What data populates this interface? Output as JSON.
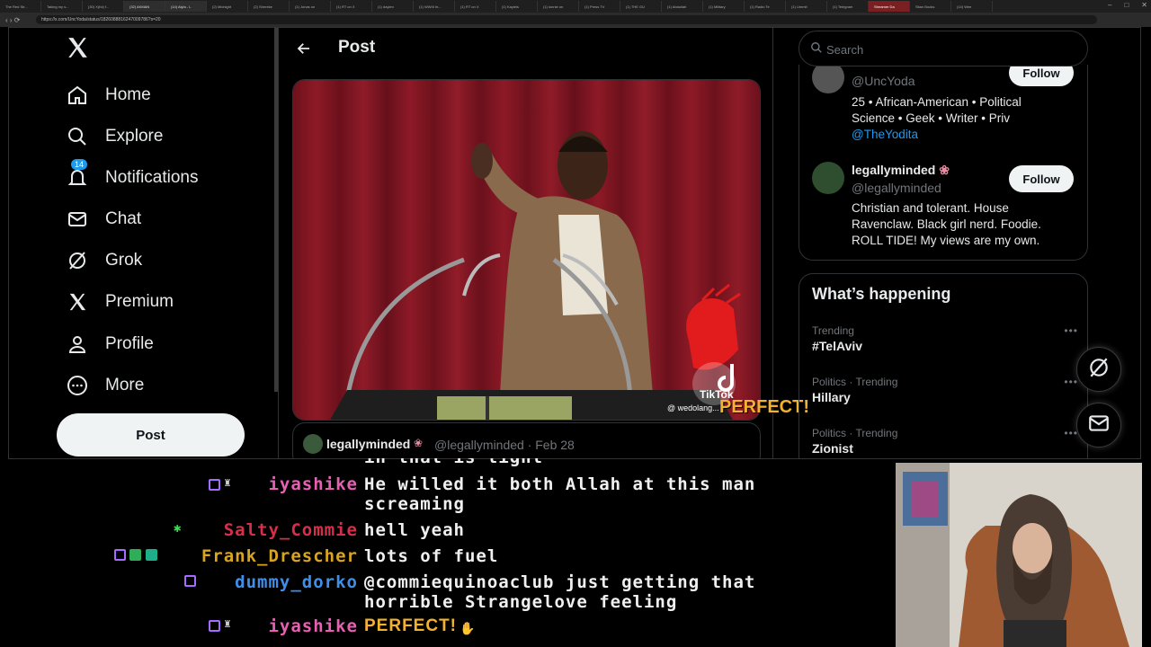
{
  "browser": {
    "tabs": [
      "The Red Str...",
      "Taking my s...",
      "(30) X(fol) f...",
      "(32) AKMAN",
      "(14) Alyla - L",
      "(2) Midnight",
      "(2) Shereke",
      "(1) Jonas on",
      "(1) RT on X",
      "(1) daylen",
      "(1) WWIII ht...",
      "(1) RT on X",
      "(1) Kaylels",
      "(1) lonnie on",
      "(1) Press TV",
      "(1) THE GU",
      "(1) Abdullah",
      "(1) Military",
      "(1) Radio Te",
      "(1) Ummit",
      "(1) Telegram",
      "Streamer Da",
      "Sitan Books",
      "(14) Wee"
    ],
    "url": "https://x.com/UncYoda/status/1826088816247009786?s=20"
  },
  "sidebar": {
    "logo": "X",
    "items": [
      {
        "label": "Home",
        "icon": "home-icon"
      },
      {
        "label": "Explore",
        "icon": "search-icon"
      },
      {
        "label": "Notifications",
        "icon": "bell-icon",
        "badge": "14"
      },
      {
        "label": "Chat",
        "icon": "mail-icon"
      },
      {
        "label": "Grok",
        "icon": "grok-icon"
      },
      {
        "label": "Premium",
        "icon": "x-logo-icon"
      },
      {
        "label": "Profile",
        "icon": "person-icon"
      },
      {
        "label": "More",
        "icon": "more-circle-icon"
      }
    ],
    "post_button": "Post"
  },
  "main": {
    "title": "Post",
    "video": {
      "tiktok_brand": "TikTok",
      "tiktok_handle": "@ wedolang...",
      "caption": "PERFECT!"
    },
    "quote": {
      "name": "legallyminded",
      "handle": "@legallyminded · Feb 28"
    }
  },
  "right": {
    "search_placeholder": "Search",
    "who_to_follow": [
      {
        "handle": "@UncYoda",
        "bio": "25 • African-American • Political Science • Geek • Writer • Priv",
        "bio_link": "@TheYodita",
        "follow": "Follow"
      },
      {
        "name": "legallyminded",
        "handle": "@legallyminded",
        "bio": "Christian and tolerant. House Ravenclaw. Black girl nerd. Foodie. ROLL TIDE! My views are my own.",
        "follow": "Follow"
      }
    ],
    "whats_happening": {
      "title": "What’s happening",
      "trends": [
        {
          "category": "Trending",
          "name": "#TelAviv"
        },
        {
          "category": "Politics · Trending",
          "name": "Hillary"
        },
        {
          "category": "Politics · Trending",
          "name": "Zionist"
        }
      ]
    }
  },
  "chat": {
    "messages": [
      {
        "user": "iyashike",
        "color": "#e95fb3",
        "lines": [
          "He willed it both Allah at this man",
          "screaming"
        ]
      },
      {
        "user": "Salty_Commie",
        "color": "#d72e4a",
        "lines": [
          "hell yeah"
        ]
      },
      {
        "user": "Frank_Drescher",
        "color": "#d9a521",
        "lines": [
          "lots of fuel"
        ]
      },
      {
        "user": "dummy_dorko",
        "color": "#3f8fe8",
        "lines": [
          "@commiequinoaclub just getting that",
          "horrible Strangelove feeling"
        ]
      },
      {
        "user": "iyashike",
        "color": "#e95fb3",
        "lines": [
          "PERFECT!"
        ]
      }
    ],
    "partial_top": "in that is tight"
  },
  "colors": {
    "accent": "#1d9bf0",
    "bg": "#000000",
    "text": "#e7e9ea",
    "muted": "#71767b",
    "border": "#2f3336"
  }
}
